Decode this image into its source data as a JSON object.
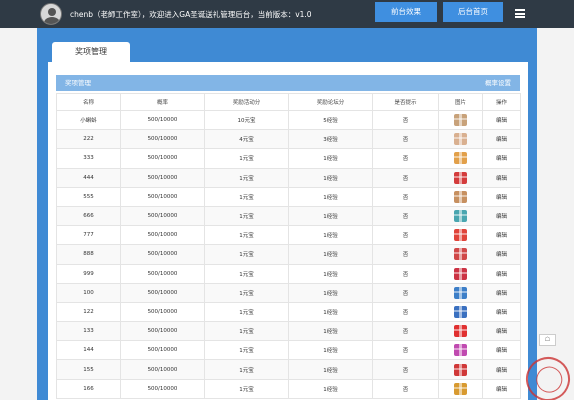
{
  "header": {
    "welcome": "chenb（老師工作室），欢迎进入GA圣诞送礼管理后台，当前版本：v1.0",
    "front_btn": "前台效果",
    "home_btn": "后台首页"
  },
  "tab": {
    "label": "奖项管理"
  },
  "panel": {
    "title": "奖项管理",
    "link": "概率设置"
  },
  "table": {
    "headers": [
      "名称",
      "概率",
      "奖励活动分",
      "奖励论坛分",
      "是否提示",
      "图片",
      "操作"
    ],
    "rows": [
      {
        "name": "小蝌蚪",
        "prob": "500/10000",
        "activity": "10元宝",
        "forum": "5经验",
        "tip": "否",
        "gift": "#c8a27a",
        "op": "编辑"
      },
      {
        "name": "222",
        "prob": "500/10000",
        "activity": "4元宝",
        "forum": "3经验",
        "tip": "否",
        "gift": "#d9b090",
        "op": "编辑"
      },
      {
        "name": "333",
        "prob": "500/10000",
        "activity": "1元宝",
        "forum": "1经验",
        "tip": "否",
        "gift": "#e2a04a",
        "op": "编辑"
      },
      {
        "name": "444",
        "prob": "500/10000",
        "activity": "1元宝",
        "forum": "1经验",
        "tip": "否",
        "gift": "#d43c3c",
        "op": "编辑"
      },
      {
        "name": "555",
        "prob": "500/10000",
        "activity": "1元宝",
        "forum": "1经验",
        "tip": "否",
        "gift": "#c79060",
        "op": "编辑"
      },
      {
        "name": "666",
        "prob": "500/10000",
        "activity": "1元宝",
        "forum": "1经验",
        "tip": "否",
        "gift": "#4aa6b0",
        "op": "编辑"
      },
      {
        "name": "777",
        "prob": "500/10000",
        "activity": "1元宝",
        "forum": "1经验",
        "tip": "否",
        "gift": "#e0443a",
        "op": "编辑"
      },
      {
        "name": "888",
        "prob": "500/10000",
        "activity": "1元宝",
        "forum": "1经验",
        "tip": "否",
        "gift": "#d04848",
        "op": "编辑"
      },
      {
        "name": "999",
        "prob": "500/10000",
        "activity": "1元宝",
        "forum": "1经验",
        "tip": "否",
        "gift": "#cc3344",
        "op": "编辑"
      },
      {
        "name": "100",
        "prob": "500/10000",
        "activity": "1元宝",
        "forum": "1经验",
        "tip": "否",
        "gift": "#3d7fc8",
        "op": "编辑"
      },
      {
        "name": "122",
        "prob": "500/10000",
        "activity": "1元宝",
        "forum": "1经验",
        "tip": "否",
        "gift": "#3a70c0",
        "op": "编辑"
      },
      {
        "name": "133",
        "prob": "500/10000",
        "activity": "1元宝",
        "forum": "1经验",
        "tip": "否",
        "gift": "#e03030",
        "op": "编辑"
      },
      {
        "name": "144",
        "prob": "500/10000",
        "activity": "1元宝",
        "forum": "1经验",
        "tip": "否",
        "gift": "#c04ab0",
        "op": "编辑"
      },
      {
        "name": "155",
        "prob": "500/10000",
        "activity": "1元宝",
        "forum": "1经验",
        "tip": "否",
        "gift": "#d03838",
        "op": "编辑"
      },
      {
        "name": "166",
        "prob": "500/10000",
        "activity": "1元宝",
        "forum": "1经验",
        "tip": "否",
        "gift": "#d89a30",
        "op": "编辑"
      }
    ]
  },
  "float_btn": "☖"
}
